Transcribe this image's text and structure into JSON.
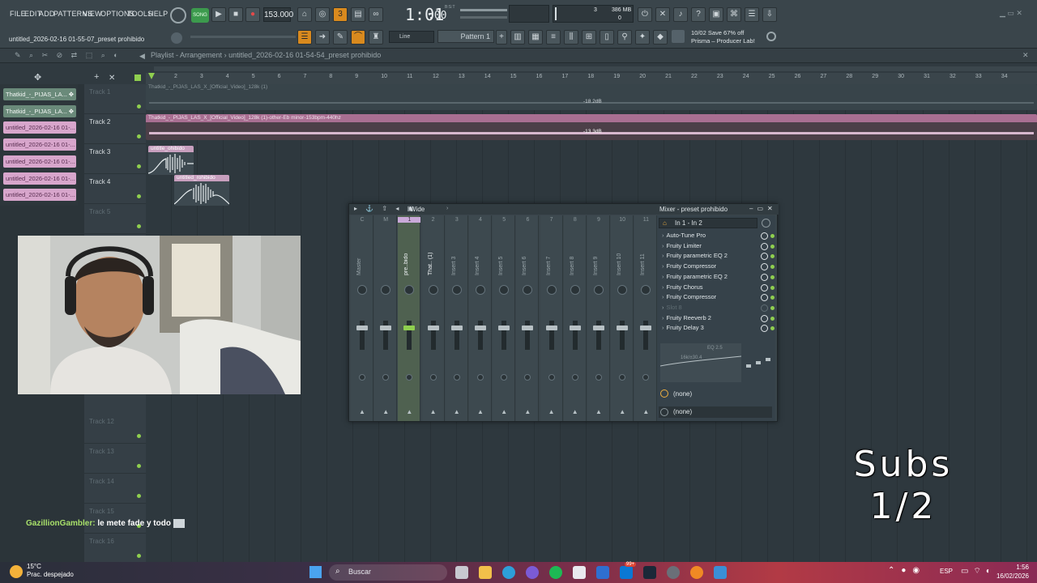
{
  "menu": [
    "FILE",
    "EDIT",
    "ADD",
    "PATTERNS",
    "VIEW",
    "OPTIONS",
    "TOOLS",
    "HELP"
  ],
  "transport": {
    "song_label": "SONG",
    "tempo": "153.000",
    "time": "1:01",
    "time_sub": ":00",
    "beat_label": "B:S:T",
    "mem": "386 MB",
    "mem_top": "3",
    "mem_bottom": "0"
  },
  "hint": {
    "title": "untitled_2026-02-16 01-55-07_preset prohibido"
  },
  "toolbar": {
    "snap": "Line",
    "pattern": "Pattern 1",
    "news_line1": "10/02  Save 67% off",
    "news_line2": "Prisma – Producer Lab!"
  },
  "playlist": {
    "breadcrumb_prefix": "Playlist - Arrangement",
    "breadcrumb_name": "untitled_2026-02-16 01-54-54_preset prohibido",
    "ruler_ticks": [
      "2",
      "3",
      "4",
      "5",
      "6",
      "7",
      "8",
      "9",
      "10",
      "11",
      "12",
      "13",
      "14",
      "15",
      "16",
      "17",
      "18",
      "19",
      "20",
      "21",
      "22",
      "23",
      "24",
      "25",
      "26",
      "27",
      "28",
      "29",
      "30",
      "31",
      "32",
      "33",
      "34"
    ],
    "tracks": [
      {
        "name": "Track 1",
        "dim": true
      },
      {
        "name": "Track 2",
        "dim": false
      },
      {
        "name": "Track 3",
        "dim": false
      },
      {
        "name": "Track 4",
        "dim": false
      },
      {
        "name": "Track 5",
        "dim": true
      },
      {
        "name": "Track 12",
        "dim": true
      },
      {
        "name": "Track 13",
        "dim": true
      },
      {
        "name": "Track 14",
        "dim": true
      },
      {
        "name": "Track 15",
        "dim": true
      },
      {
        "name": "Track 16",
        "dim": true
      }
    ],
    "clips": {
      "track1": "Thatkid_-_PIJAS_LAS_X_[Official_Video]_128k (1)",
      "track1_db": "-18.2dB",
      "track2": "Thatkid_-_PIJAS_LAS_X_[Official_Video]_128k (1)-other-Eb minor-153bpm-440hz",
      "track2_db": "-13.3dB",
      "track3": "untitle_ohibido",
      "track4": "untitled_rohibido"
    }
  },
  "picker": [
    {
      "label": "Thatkid_-_PIJAS_LA...",
      "color": "green"
    },
    {
      "label": "Thatkid_-_PIJAS_LA...",
      "color": "green"
    },
    {
      "label": "untitled_2026-02-16 01-...",
      "color": "pink"
    },
    {
      "label": "untitled_2026-02-16 01-...",
      "color": "pink"
    },
    {
      "label": "untitled_2026-02-16 01-...",
      "color": "pink"
    },
    {
      "label": "untitled_2026-02-16 01-...",
      "color": "pink"
    },
    {
      "label": "untitled_2026-02-16 01-...",
      "color": "pink"
    }
  ],
  "mixer": {
    "view_label": "Wide",
    "title": "Mixer - preset prohibido",
    "input": "In 1 - In 2",
    "strips": [
      {
        "num": "C",
        "name": "Master"
      },
      {
        "num": "M",
        "name": ""
      },
      {
        "num": "1",
        "name": "pre..bido"
      },
      {
        "num": "2",
        "name": "That.. (1)"
      },
      {
        "num": "3",
        "name": "Insert 3"
      },
      {
        "num": "4",
        "name": "Insert 4"
      },
      {
        "num": "5",
        "name": "Insert 5"
      },
      {
        "num": "6",
        "name": "Insert 6"
      },
      {
        "num": "7",
        "name": "Insert 7"
      },
      {
        "num": "8",
        "name": "Insert 8"
      },
      {
        "num": "9",
        "name": "Insert 9"
      },
      {
        "num": "10",
        "name": "Insert 10"
      },
      {
        "num": "11",
        "name": "Insert 11"
      }
    ],
    "effects": [
      {
        "name": "Auto-Tune Pro",
        "dim": false
      },
      {
        "name": "Fruity Limiter",
        "dim": false
      },
      {
        "name": "Fruity parametric EQ 2",
        "dim": false
      },
      {
        "name": "Fruity Compressor",
        "dim": false
      },
      {
        "name": "Fruity parametric EQ 2",
        "dim": false
      },
      {
        "name": "Fruity Chorus",
        "dim": false
      },
      {
        "name": "Fruity Compressor",
        "dim": false
      },
      {
        "name": "Slot 8",
        "dim": true
      },
      {
        "name": "Fruity Reeverb 2",
        "dim": false
      },
      {
        "name": "Fruity Delay 3",
        "dim": false
      }
    ],
    "eq_label1": "EQ 2.5",
    "eq_label2": "16k/±30.4",
    "out1": "(none)",
    "out2": "(none)"
  },
  "overlay": {
    "subs_line1": "Subs",
    "subs_line2": "1/2",
    "chat_user": "GazillionGambler:",
    "chat_msg": "le mete fade y todo"
  },
  "taskbar": {
    "temp": "15°C",
    "weather": "Prac. despejado",
    "search": "Buscar",
    "badge": "99+",
    "lang": "ESP",
    "clock_time": "1:56",
    "clock_date": "16/02/2026"
  }
}
